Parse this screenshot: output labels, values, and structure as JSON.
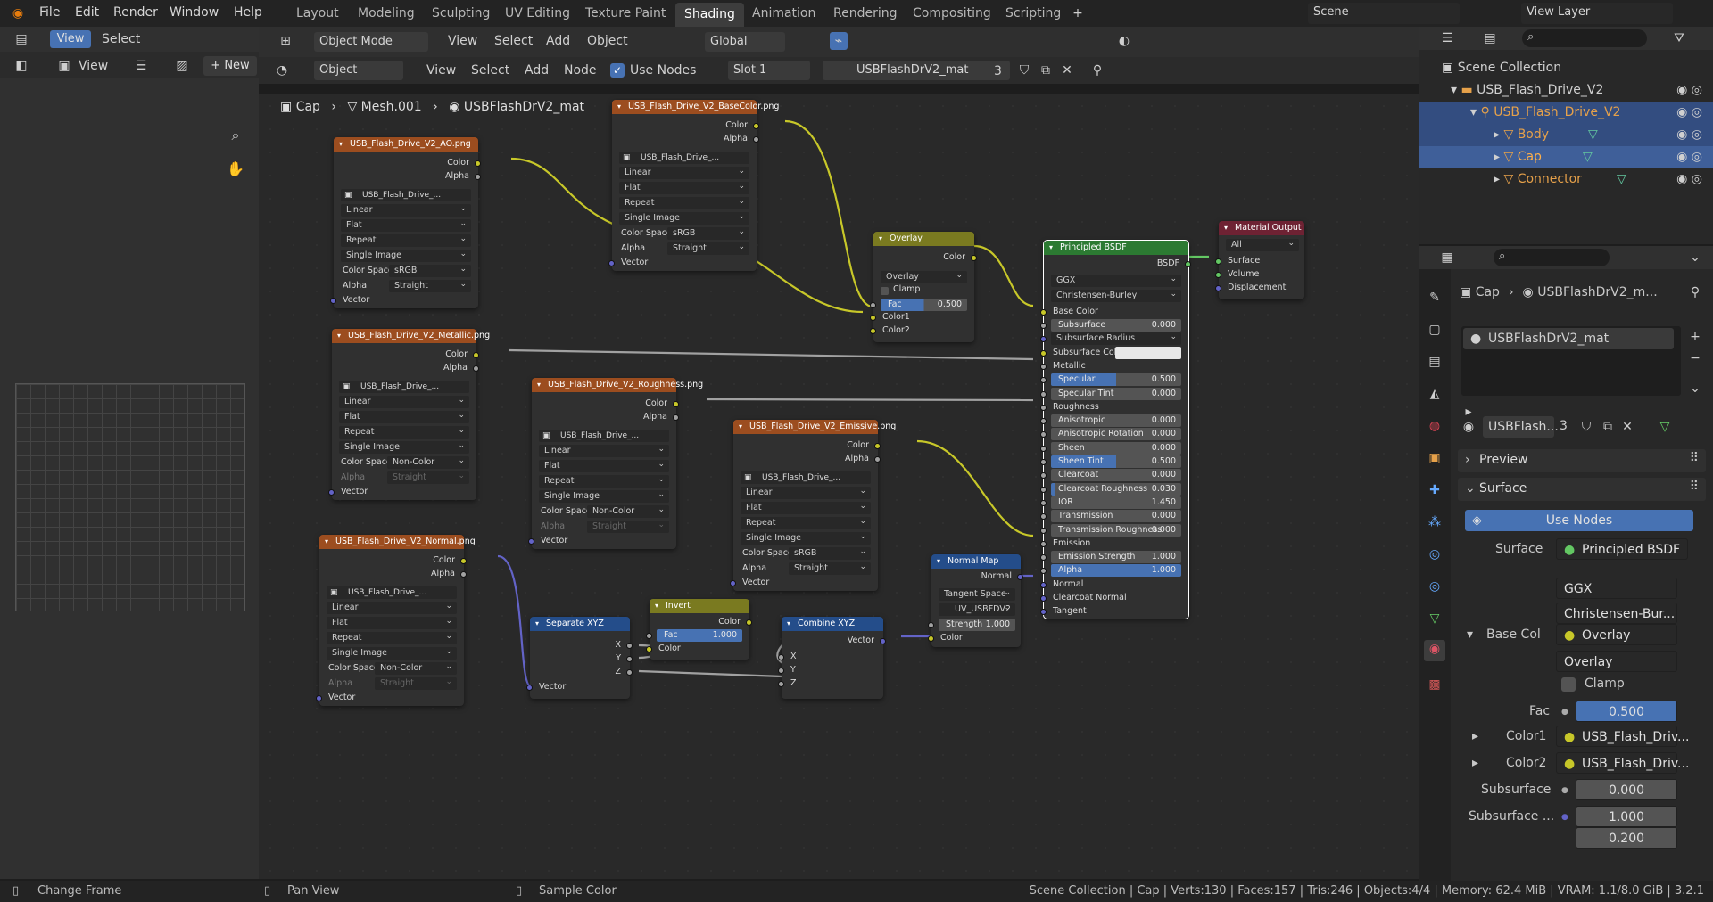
{
  "menu": {
    "file": "File",
    "edit": "Edit",
    "render": "Render",
    "window": "Window",
    "help": "Help"
  },
  "workspaces": [
    "Layout",
    "Modeling",
    "Sculpting",
    "UV Editing",
    "Texture Paint",
    "Shading",
    "Animation",
    "Rendering",
    "Compositing",
    "Scripting"
  ],
  "scene": {
    "name": "Scene",
    "view_layer": "View Layer"
  },
  "left": {
    "view": "View",
    "select": "Select",
    "view2": "View",
    "new": "New"
  },
  "viewport_header": {
    "mode": "Object Mode",
    "view": "View",
    "select": "Select",
    "add": "Add",
    "object": "Object",
    "orientation": "Global"
  },
  "node_header": {
    "type": "Object",
    "view": "View",
    "select": "Select",
    "add": "Add",
    "node": "Node",
    "use_nodes": "Use Nodes",
    "slot": "Slot 1",
    "material": "USBFlashDrV2_mat",
    "users": "3"
  },
  "breadcrumb": {
    "object": "Cap",
    "mesh": "Mesh.001",
    "material": "USBFlashDrV2_mat"
  },
  "tex_opts": {
    "interp": "Linear",
    "proj": "Flat",
    "ext": "Repeat",
    "source": "Single Image",
    "cs": "Color Space",
    "alpha": "Alpha",
    "straight": "Straight",
    "srgb": "sRGB",
    "noncolor": "Non-Color",
    "vector": "Vector",
    "color": "Color",
    "alpha_out": "Alpha",
    "imgname": "USB_Flash_Drive_..."
  },
  "nodes": {
    "ao": "USB_Flash_Drive_V2_AO.png",
    "base": "USB_Flash_Drive_V2_BaseColor.png",
    "metal": "USB_Flash_Drive_V2_Metallic.png",
    "rough": "USB_Flash_Drive_V2_Roughness.png",
    "emis": "USB_Flash_Drive_V2_Emissive.png",
    "normal": "USB_Flash_Drive_V2_Normal.png",
    "overlay": {
      "title": "Overlay",
      "color": "Color",
      "mode": "Overlay",
      "clamp": "Clamp",
      "fac": "Fac",
      "fac_val": "0.500",
      "c1": "Color1",
      "c2": "Color2"
    },
    "sepxyz": {
      "title": "Separate XYZ",
      "x": "X",
      "y": "Y",
      "z": "Z",
      "vector": "Vector"
    },
    "invert": {
      "title": "Invert",
      "color": "Color",
      "fac": "Fac",
      "fac_val": "1.000",
      "color_in": "Color"
    },
    "combxyz": {
      "title": "Combine XYZ",
      "vector": "Vector",
      "x": "X",
      "y": "Y",
      "z": "Z"
    },
    "normalmap": {
      "title": "Normal Map",
      "normal": "Normal",
      "space": "Tangent Space",
      "uv": "UV_USBFDV2",
      "strength": "Strength",
      "strength_val": "1.000",
      "color": "Color"
    },
    "matout": {
      "title": "Material Output",
      "target": "All",
      "surface": "Surface",
      "volume": "Volume",
      "disp": "Displacement"
    },
    "bsdf": {
      "title": "Principled BSDF",
      "bsdf": "BSDF",
      "dist": "GGX",
      "sss": "Christensen-Burley",
      "base": "Base Color",
      "rows": [
        [
          "Subsurface",
          "0.000",
          0
        ],
        [
          "Subsurface Radius",
          "",
          -1
        ],
        [
          "Subsurface Color",
          "",
          -2
        ],
        [
          "Metallic",
          "",
          -3
        ],
        [
          "Specular",
          "0.500",
          0.5
        ],
        [
          "Specular Tint",
          "0.000",
          0
        ],
        [
          "Roughness",
          "",
          -3
        ],
        [
          "Anisotropic",
          "0.000",
          0
        ],
        [
          "Anisotropic Rotation",
          "0.000",
          0
        ],
        [
          "Sheen",
          "0.000",
          0
        ],
        [
          "Sheen Tint",
          "0.500",
          0.5
        ],
        [
          "Clearcoat",
          "0.000",
          0
        ],
        [
          "Clearcoat Roughness",
          "0.030",
          0.03
        ],
        [
          "IOR",
          "1.450",
          0
        ],
        [
          "Transmission",
          "0.000",
          0
        ],
        [
          "Transmission Roughness",
          "0.000",
          0
        ],
        [
          "Emission",
          "",
          -3
        ],
        [
          "Emission Strength",
          "1.000",
          0
        ],
        [
          "Alpha",
          "1.000",
          1
        ],
        [
          "Normal",
          "",
          -3
        ],
        [
          "Clearcoat Normal",
          "",
          -3
        ],
        [
          "Tangent",
          "",
          -3
        ]
      ]
    }
  },
  "outliner": {
    "root": "Scene Collection",
    "coll": "USB_Flash_Drive_V2",
    "obj": "USB_Flash_Drive_V2",
    "body": "Body",
    "cap": "Cap",
    "connector": "Connector"
  },
  "props": {
    "crumb_obj": "Cap",
    "crumb_mat": "USBFlashDrV2_m...",
    "slot": "USBFlashDrV2_mat",
    "mat_short": "USBFlash...",
    "users": "3",
    "preview": "Preview",
    "surface_hdr": "Surface",
    "use_nodes": "Use Nodes",
    "surface_lbl": "Surface",
    "surface_val": "Principled BSDF",
    "dist": "GGX",
    "sss": "Christensen-Bur...",
    "basecol": "Base Col",
    "basecol_val": "Overlay",
    "blend": "Overlay",
    "clamp": "Clamp",
    "fac": "Fac",
    "fac_val": "0.500",
    "color1": "Color1",
    "color1_val": "USB_Flash_Driv...",
    "color2": "Color2",
    "color2_val": "USB_Flash_Driv...",
    "subsurface": "Subsurface",
    "subsurface_val": "0.000",
    "subsurf2": "Subsurface ...",
    "sr1": "1.000",
    "sr2": "0.200"
  },
  "status": {
    "a": "Change Frame",
    "b": "Pan View",
    "c": "Sample Color",
    "info": "Scene Collection | Cap | Verts:130 | Faces:157 | Tris:246 | Objects:4/4 | Memory: 62.4 MiB | VRAM: 1.1/8.0 GiB | 3.2.1"
  }
}
